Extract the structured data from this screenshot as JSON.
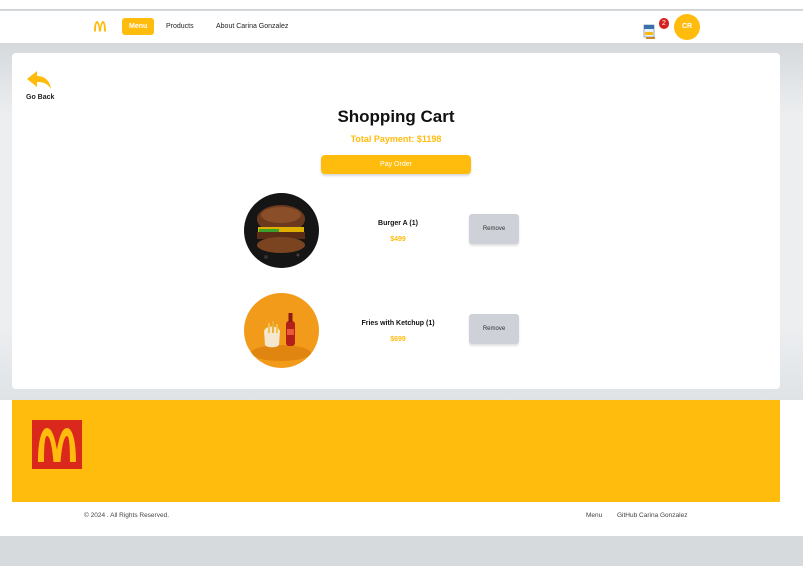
{
  "nav": {
    "logo_icon": "mcdonalds-arches-icon",
    "links": [
      "Menu",
      "Products",
      "About Carina Gonzalez"
    ],
    "cart_icon": "shopping-bag-icon",
    "cart_count": "2",
    "avatar_initials": "CR"
  },
  "back": {
    "icon": "back-arrow-icon",
    "label": "Go Back"
  },
  "cart": {
    "title": "Shopping Cart",
    "total": "Total Payment: $1198",
    "pay_label": "Pay Order",
    "items": [
      {
        "name": "Burger A (1)",
        "price": "$499",
        "remove_label": "Remove",
        "image": "burger-photo"
      },
      {
        "name": "Fries with Ketchup (1)",
        "price": "$699",
        "remove_label": "Remove",
        "image": "fries-photo"
      }
    ]
  },
  "footer": {
    "logo_icon": "mcdonalds-logo-icon",
    "copyright": "© 2024 . All Rights Reserved.",
    "links": [
      "Menu",
      "GitHub Carina Gonzalez"
    ]
  },
  "colors": {
    "accent": "#ffbc0d",
    "brand_red": "#da291c",
    "badge_red": "#d71f1f"
  }
}
